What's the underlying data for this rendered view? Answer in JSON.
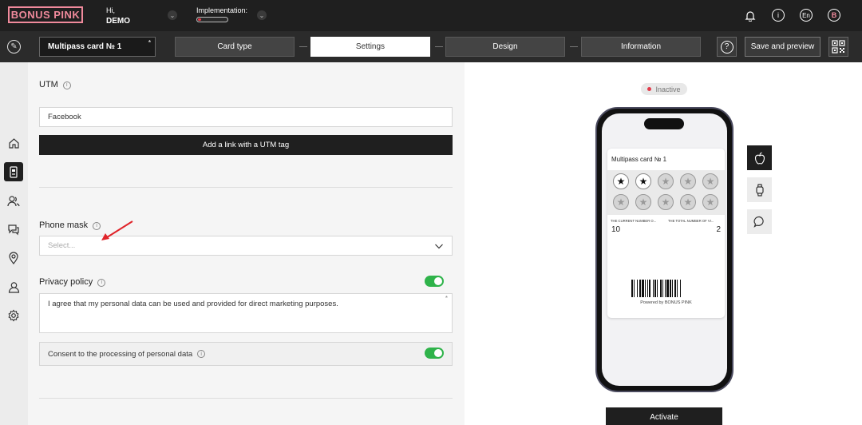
{
  "brand": {
    "logo": "BONUS PINK",
    "accent": "#f08a9c"
  },
  "header": {
    "greeting": "Hi,",
    "user": "DEMO",
    "implementation_label": "Implementation:",
    "implementation_progress": 0.12,
    "language": "En",
    "user_initial": "B",
    "icons": [
      "bell-icon",
      "info-icon",
      "language-icon",
      "user-icon"
    ]
  },
  "toolbar": {
    "card_name": "Multipass card № 1",
    "required_mark": "*",
    "steps": [
      "Card type",
      "Settings",
      "Design",
      "Information"
    ],
    "active_step": "Settings",
    "help": "?",
    "save_preview": "Save and preview"
  },
  "sidebar": {
    "icons": [
      "home-icon",
      "card-icon",
      "clients-icon",
      "chat-icon",
      "location-icon",
      "user-icon",
      "settings-icon"
    ],
    "active": "card-icon"
  },
  "form": {
    "utm": {
      "label": "UTM",
      "value": "Facebook",
      "button": "Add a link with a UTM tag"
    },
    "phone_mask": {
      "label": "Phone mask",
      "placeholder": "Select..."
    },
    "privacy": {
      "label": "Privacy policy",
      "text": "I agree that my personal data can be used and provided for direct marketing purposes.",
      "required_mark": "*",
      "enabled": true
    },
    "consent": {
      "label": "Consent to the processing of personal data",
      "enabled": true
    }
  },
  "preview": {
    "status": "Inactive",
    "status_color": "#e23b4a",
    "card_title": "Multipass card № 1",
    "stamps_total": 10,
    "stamps_filled": 2,
    "current_label": "THE CURRENT NUMBER O...",
    "total_label": "THE TOTAL NUMBER OF VI...",
    "current_value": "10",
    "total_value": "2",
    "powered": "Powered by BONUS PINK",
    "platforms": [
      "apple-icon",
      "watch-icon",
      "message-icon"
    ],
    "activate": "Activate"
  }
}
